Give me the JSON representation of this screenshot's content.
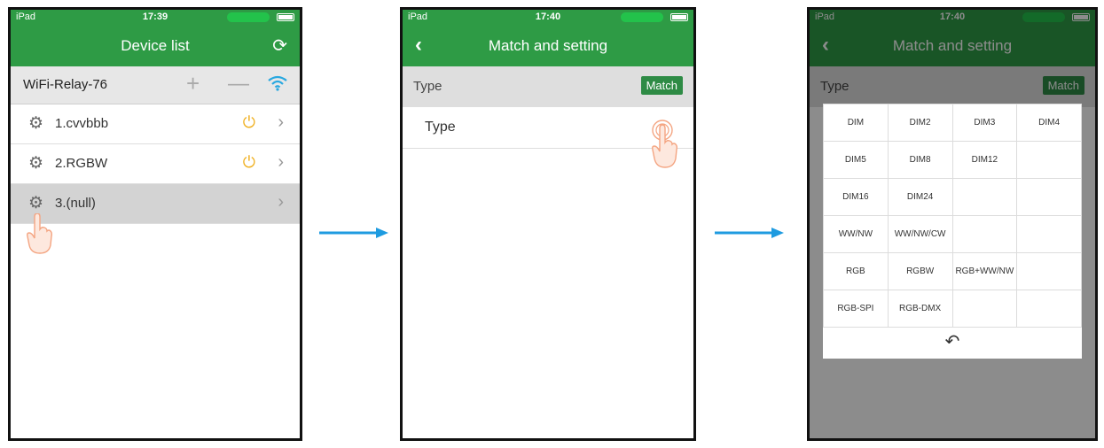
{
  "screen1": {
    "status": {
      "carrier": "iPad",
      "time": "17:39"
    },
    "title": "Device list",
    "refresh_icon": "refresh-icon",
    "group": {
      "name": "WiFi-Relay-76",
      "add": "+",
      "remove": "—"
    },
    "devices": [
      {
        "label": "1.cvvbbb",
        "has_power": true
      },
      {
        "label": "2.RGBW",
        "has_power": true
      },
      {
        "label": "3.(null)",
        "has_power": false,
        "selected": true
      }
    ]
  },
  "screen2": {
    "status": {
      "carrier": "iPad",
      "time": "17:40"
    },
    "title": "Match and setting",
    "type_label": "Type",
    "match_button": "Match",
    "type_row": "Type"
  },
  "screen3": {
    "status": {
      "carrier": "iPad",
      "time": "17:40"
    },
    "title": "Match and setting",
    "type_label": "Type",
    "match_button": "Match",
    "options": [
      [
        "DIM",
        "DIM2",
        "DIM3",
        "DIM4"
      ],
      [
        "DIM5",
        "DIM8",
        "DIM12",
        ""
      ],
      [
        "DIM16",
        "DIM24",
        "",
        ""
      ],
      [
        "WW/NW",
        "WW/NW/CW",
        "",
        ""
      ],
      [
        "RGB",
        "RGBW",
        "RGB+WW/NW",
        ""
      ],
      [
        "RGB-SPI",
        "RGB-DMX",
        "",
        ""
      ]
    ],
    "return_icon": "return-icon"
  },
  "colors": {
    "green": "#2e9b45",
    "accent_arrow": "#1e9be0",
    "power": "#f0b020",
    "wifi": "#29a8e0"
  }
}
